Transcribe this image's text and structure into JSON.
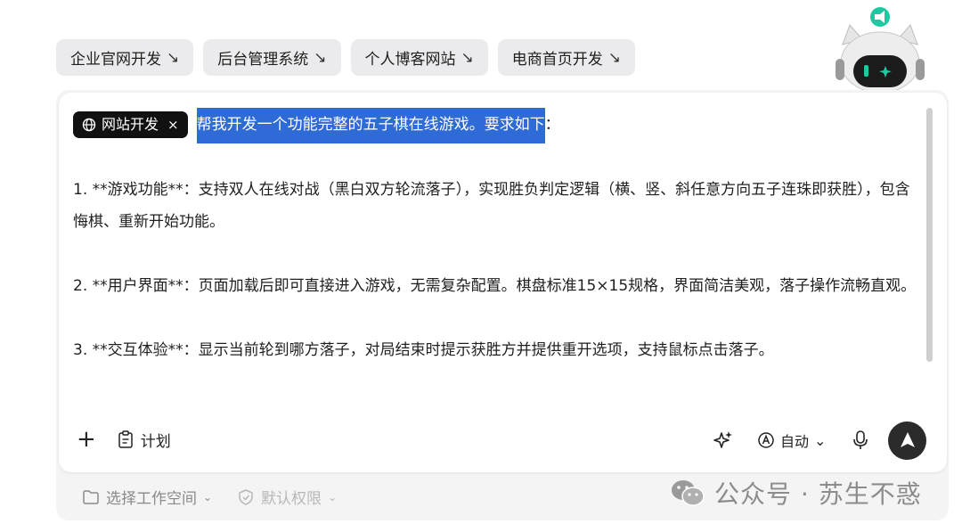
{
  "quick_chips": [
    {
      "label": "企业官网开发",
      "arrow": "↘"
    },
    {
      "label": "后台管理系统",
      "arrow": "↘"
    },
    {
      "label": "个人博客网站",
      "arrow": "↘"
    },
    {
      "label": "电商首页开发",
      "arrow": "↘"
    }
  ],
  "input": {
    "tag_label": "网站开发",
    "tag_close": "×",
    "highlighted_text": "帮我开发一个功能完整的五子棋在线游戏。要求如下",
    "after_highlight": "：",
    "paragraphs": [
      "1. **游戏功能**：支持双人在线对战（黑白双方轮流落子），实现胜负判定逻辑（横、竖、斜任意方向五子连珠即获胜），包含悔棋、重新开始功能。",
      "2. **用户界面**：页面加载后即可直接进入游戏，无需复杂配置。棋盘标准15×15规格，界面简洁美观，落子操作流畅直观。",
      "3. **交互体验**：显示当前轮到哪方落子，对局结束时提示获胜方并提供重开选项，支持鼠标点击落子。"
    ]
  },
  "toolbar": {
    "plus_label": "+",
    "plan_label": "计划",
    "auto_label": "自动",
    "auto_chevron": "⌄"
  },
  "footer": {
    "workspace_label": "选择工作空间",
    "permission_label": "默认权限",
    "chevron": "⌄"
  },
  "watermark": {
    "text": "公众号 · 苏生不惑"
  },
  "colors": {
    "highlight": "#2f6bd6",
    "mascot_accent": "#1ec8a0"
  }
}
